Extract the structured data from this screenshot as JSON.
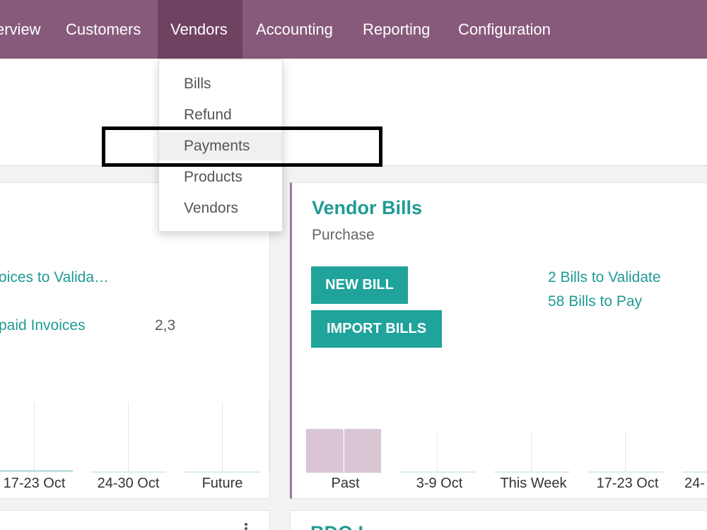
{
  "nav": {
    "items": [
      {
        "label": "Overview",
        "display": "erview"
      },
      {
        "label": "Customers"
      },
      {
        "label": "Vendors",
        "active": true
      },
      {
        "label": "Accounting"
      },
      {
        "label": "Reporting"
      },
      {
        "label": "Configuration"
      }
    ]
  },
  "vendors_menu": {
    "items": [
      "Bills",
      "Refund",
      "Payments",
      "Products",
      "Vendors"
    ],
    "highlighted": "Payments"
  },
  "customer_invoices_card": {
    "link_validate": "oices to Valida…",
    "link_unpaid": "paid Invoices",
    "unpaid_amount": "2,3",
    "graph_ticks": [
      "17-23 Oct",
      "24-30 Oct",
      "Future"
    ]
  },
  "vendor_bills_card": {
    "title": "Vendor Bills",
    "subtitle": "Purchase",
    "new_bill_button": "NEW BILL",
    "import_bills_button": "IMPORT BILLS",
    "link_validate": "2 Bills to Validate",
    "link_pay": "58 Bills to Pay",
    "graph_ticks": [
      "Past",
      "3-9 Oct",
      "This Week",
      "17-23 Oct",
      "24-"
    ]
  },
  "bottom_card": {
    "title_partial": "BDO I"
  },
  "colors": {
    "nav_bg": "#875a7b",
    "nav_active": "#6f4262",
    "accent_teal": "#1fa39b",
    "link_teal": "#1f9b94",
    "card_border_purple": "#9a76a9",
    "past_bar": "#d9c5d3"
  },
  "chart_data": [
    {
      "type": "bar",
      "categories": [
        "Past",
        "3-9 Oct",
        "This Week",
        "17-23 Oct",
        "24-"
      ],
      "series": [
        {
          "values": [
            1,
            0,
            0,
            0,
            0
          ]
        }
      ]
    }
  ]
}
